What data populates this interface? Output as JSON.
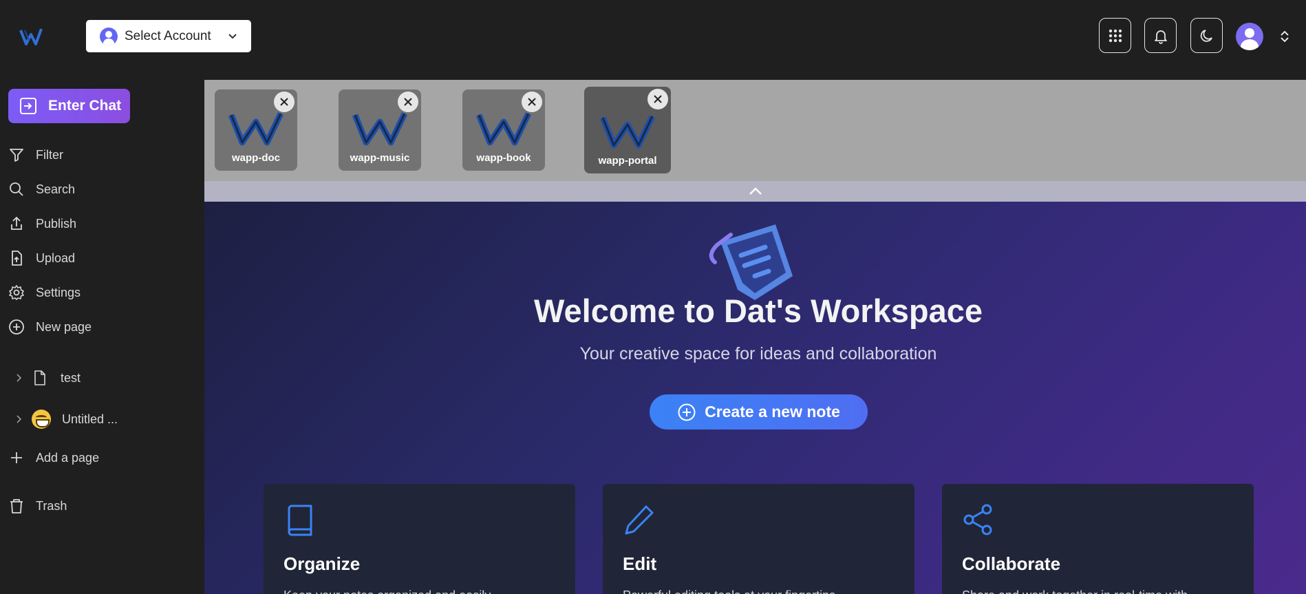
{
  "header": {
    "account_select": "Select Account",
    "icons": [
      "apps-grid-icon",
      "bell-icon",
      "moon-icon"
    ]
  },
  "sidebar": {
    "enter_chat": "Enter Chat",
    "items": [
      {
        "label": "Filter",
        "icon": "filter-icon"
      },
      {
        "label": "Search",
        "icon": "search-icon"
      },
      {
        "label": "Publish",
        "icon": "publish-icon"
      },
      {
        "label": "Upload",
        "icon": "upload-icon"
      },
      {
        "label": "Settings",
        "icon": "gear-icon"
      },
      {
        "label": "New page",
        "icon": "plus-circle-icon"
      }
    ],
    "pages": [
      {
        "label": "test",
        "icon": "file-icon"
      },
      {
        "label": "Untitled ...",
        "icon": "grin-emoji-icon"
      }
    ],
    "add_page": "Add a page",
    "trash": "Trash"
  },
  "apps": [
    {
      "label": "wapp-doc"
    },
    {
      "label": "wapp-music"
    },
    {
      "label": "wapp-book"
    },
    {
      "label": "wapp-portal"
    }
  ],
  "main": {
    "title": "Welcome to Dat's Workspace",
    "subtitle": "Your creative space for ideas and collaboration",
    "create_button": "Create a new note",
    "cards": [
      {
        "title": "Organize",
        "desc": "Keep your notes organized and easily",
        "icon": "book-icon"
      },
      {
        "title": "Edit",
        "desc": "Powerful editing tools at your fingertips",
        "icon": "pencil-icon"
      },
      {
        "title": "Collaborate",
        "desc": "Share and work together in real-time with",
        "icon": "share-icon"
      }
    ]
  },
  "colors": {
    "accent_purple": "#7c5cf6",
    "accent_blue": "#3b82f6",
    "card_bg": "#202637"
  }
}
